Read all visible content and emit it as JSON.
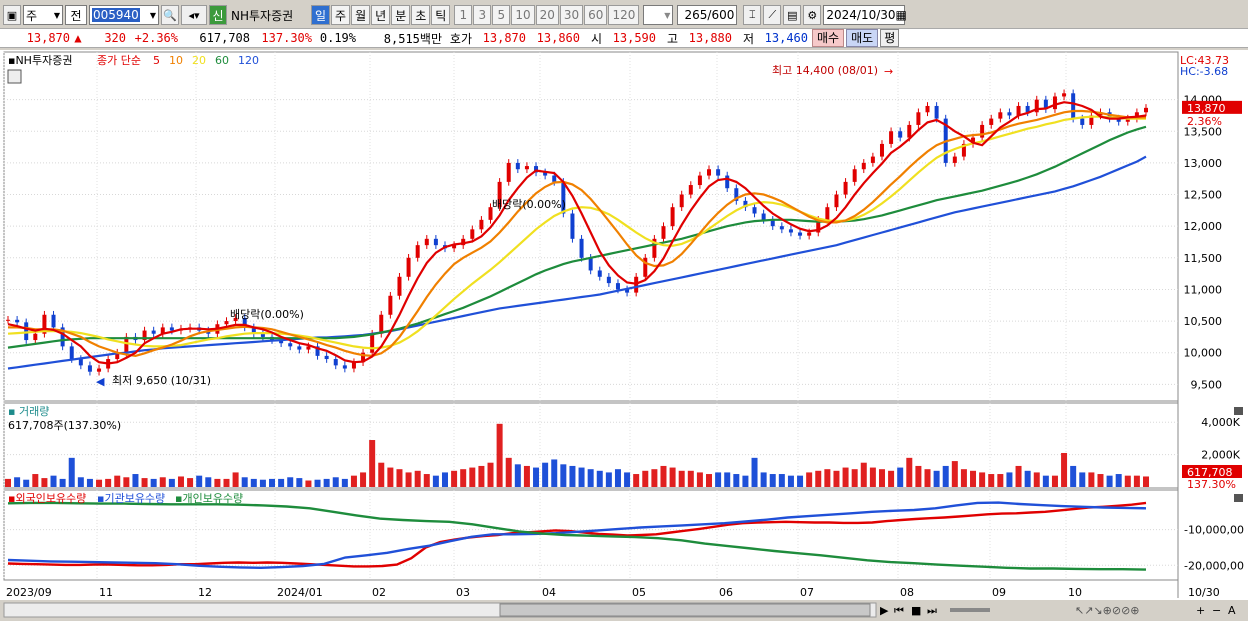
{
  "toolbar": {
    "period_type": "주",
    "prev_label": "전",
    "stock_code": "005940",
    "new_badge": "신",
    "stock_name": "NH투자증권",
    "period_tabs": [
      "일",
      "주",
      "월",
      "년",
      "분",
      "초",
      "틱"
    ],
    "selected_period": "일",
    "interval_buttons": [
      "1",
      "3",
      "5",
      "10",
      "20",
      "30",
      "60",
      "120"
    ],
    "count_value": "265",
    "count_total": "/600",
    "date_value": "2024/10/30"
  },
  "quote": {
    "price": "13,870",
    "arrow": "▲",
    "change": "320",
    "change_pct": "+2.36%",
    "volume": "617,708",
    "volume_ratio": "137.30%",
    "turnover": "0.19%",
    "amount": "8,515백만",
    "ask_label": "호가",
    "ask": "13,870",
    "bid": "13,860",
    "open_label": "시",
    "open": "13,590",
    "high_label": "고",
    "high": "13,880",
    "low_label": "저",
    "low": "13,460",
    "buy_label": "매수",
    "sell_label": "매도",
    "eval_label": "평"
  },
  "chart_data": {
    "type": "line",
    "price_panel": {
      "title": "NH투자증권",
      "legend_prefix": "종가 단순",
      "ma_periods": [
        "5",
        "10",
        "20",
        "60",
        "120"
      ],
      "ma_colors": [
        "#e00000",
        "#f08000",
        "#f0e020",
        "#1e8c3c",
        "#2050d8"
      ],
      "ylim": [
        9300,
        14500
      ],
      "yticks": [
        "14,000",
        "13,500",
        "13,000",
        "12,500",
        "12,000",
        "11,500",
        "11,000",
        "10,500",
        "10,000",
        "9,500"
      ],
      "lc_label": "LC:43.73",
      "hc_label": "HC:-3.68",
      "current_price_label": "13,870",
      "current_pct_label": "2.36%",
      "annotations": [
        {
          "text": "최고 14,400 (08/01)",
          "x": "2024/08/01",
          "y": 14400
        },
        {
          "text": "최저 9,650 (10/31)",
          "x": "2023/10/31",
          "y": 9650
        },
        {
          "text": "배당락(0.00%)",
          "x": "2023/12/27",
          "y": 10300
        },
        {
          "text": "배당락(0.00%)",
          "x": "2024/03/28",
          "y": 12000
        }
      ],
      "close_series": [
        10520,
        10480,
        10200,
        10300,
        10600,
        10400,
        10100,
        9900,
        9800,
        9700,
        9750,
        9900,
        10000,
        10250,
        10200,
        10350,
        10300,
        10400,
        10350,
        10380,
        10400,
        10350,
        10300,
        10450,
        10500,
        10550,
        10400,
        10300,
        10250,
        10200,
        10150,
        10100,
        10050,
        10100,
        9950,
        9900,
        9800,
        9750,
        9850,
        10000,
        10300,
        10600,
        10900,
        11200,
        11500,
        11700,
        11800,
        11700,
        11650,
        11700,
        11800,
        11950,
        12100,
        12300,
        12700,
        13000,
        12900,
        12950,
        12850,
        12800,
        12700,
        12200,
        11800,
        11500,
        11300,
        11200,
        11100,
        11000,
        10950,
        11200,
        11500,
        11800,
        12000,
        12300,
        12500,
        12650,
        12800,
        12900,
        12800,
        12600,
        12400,
        12300,
        12200,
        12100,
        12000,
        11950,
        11900,
        11850,
        11900,
        12100,
        12300,
        12500,
        12700,
        12900,
        13000,
        13100,
        13300,
        13500,
        13400,
        13600,
        13800,
        13900,
        13700,
        13000,
        13100,
        13300,
        13400,
        13600,
        13700,
        13800,
        13750,
        13900,
        13800,
        14000,
        13850,
        14050,
        14100,
        13700,
        13600,
        13750,
        13800,
        13700,
        13650,
        13700,
        13800,
        13870
      ],
      "ma5": [
        10450,
        10420,
        10380,
        10350,
        10380,
        10360,
        10300,
        10200,
        10100,
        9950,
        9850,
        9830,
        9850,
        9920,
        10000,
        10150,
        10230,
        10300,
        10330,
        10370,
        10380,
        10380,
        10370,
        10380,
        10410,
        10440,
        10440,
        10400,
        10370,
        10320,
        10250,
        10200,
        10150,
        10120,
        10070,
        10030,
        9960,
        9880,
        9850,
        9860,
        9940,
        10100,
        10330,
        10600,
        10900,
        11180,
        11420,
        11580,
        11670,
        11710,
        11730,
        11760,
        11840,
        11980,
        12170,
        12410,
        12600,
        12770,
        12880,
        12860,
        12840,
        12700,
        12480,
        12200,
        11900,
        11600,
        11380,
        11220,
        11110,
        11090,
        11150,
        11290,
        11490,
        11760,
        12020,
        12250,
        12450,
        12630,
        12730,
        12750,
        12700,
        12600,
        12460,
        12320,
        12200,
        12110,
        12030,
        11960,
        11920,
        11940,
        12010,
        12130,
        12300,
        12500,
        12680,
        12840,
        12990,
        13160,
        13260,
        13380,
        13520,
        13640,
        13680,
        13600,
        13500,
        13420,
        13320,
        13280,
        13420,
        13560,
        13650,
        13750,
        13790,
        13850,
        13860,
        13920,
        13960,
        13940,
        13900,
        13840,
        13730,
        13700,
        13700,
        13720,
        13730,
        13750
      ],
      "ma10": [
        10400,
        10400,
        10390,
        10370,
        10370,
        10370,
        10350,
        10300,
        10250,
        10170,
        10100,
        10050,
        10000,
        9970,
        9950,
        9990,
        10040,
        10080,
        10130,
        10190,
        10260,
        10310,
        10340,
        10360,
        10380,
        10400,
        10410,
        10400,
        10390,
        10370,
        10330,
        10290,
        10250,
        10210,
        10170,
        10120,
        10080,
        10030,
        9990,
        9960,
        9950,
        9990,
        10090,
        10250,
        10450,
        10660,
        10880,
        11080,
        11250,
        11400,
        11500,
        11580,
        11660,
        11760,
        11900,
        12060,
        12230,
        12380,
        12520,
        12620,
        12690,
        12700,
        12660,
        12570,
        12430,
        12260,
        12080,
        11900,
        11710,
        11540,
        11420,
        11370,
        11380,
        11440,
        11560,
        11720,
        11890,
        12060,
        12210,
        12340,
        12440,
        12500,
        12520,
        12500,
        12450,
        12390,
        12310,
        12230,
        12150,
        12090,
        12060,
        12060,
        12090,
        12160,
        12260,
        12380,
        12520,
        12660,
        12790,
        12930,
        13060,
        13180,
        13280,
        13340,
        13380,
        13420,
        13440,
        13450,
        13480,
        13530,
        13580,
        13620,
        13650,
        13680,
        13720,
        13760,
        13800,
        13820,
        13820,
        13810,
        13790,
        13760,
        13740,
        13720,
        13720,
        13720
      ],
      "ma20": [
        10300,
        10310,
        10320,
        10330,
        10340,
        10340,
        10340,
        10330,
        10310,
        10280,
        10250,
        10210,
        10180,
        10150,
        10130,
        10110,
        10100,
        10100,
        10110,
        10120,
        10150,
        10180,
        10210,
        10230,
        10260,
        10280,
        10300,
        10310,
        10310,
        10310,
        10300,
        10290,
        10270,
        10250,
        10220,
        10190,
        10160,
        10130,
        10100,
        10080,
        10070,
        10080,
        10110,
        10160,
        10240,
        10340,
        10460,
        10590,
        10720,
        10850,
        10970,
        11090,
        11200,
        11310,
        11430,
        11560,
        11690,
        11820,
        11950,
        12060,
        12160,
        12230,
        12280,
        12300,
        12290,
        12250,
        12190,
        12100,
        12000,
        11900,
        11810,
        11740,
        11700,
        11690,
        11720,
        11780,
        11860,
        11960,
        12060,
        12160,
        12250,
        12320,
        12360,
        12380,
        12370,
        12340,
        12290,
        12230,
        12170,
        12120,
        12090,
        12080,
        12090,
        12120,
        12180,
        12260,
        12360,
        12470,
        12590,
        12720,
        12850,
        12970,
        13080,
        13160,
        13220,
        13270,
        13310,
        13340,
        13380,
        13420,
        13460,
        13500,
        13540,
        13570,
        13610,
        13640,
        13680,
        13700,
        13720,
        13730,
        13730,
        13720,
        13710,
        13700,
        13700,
        13700
      ],
      "ma60": [
        10080,
        10100,
        10120,
        10140,
        10160,
        10180,
        10200,
        10210,
        10220,
        10230,
        10230,
        10230,
        10230,
        10230,
        10230,
        10230,
        10230,
        10230,
        10230,
        10230,
        10230,
        10230,
        10230,
        10230,
        10230,
        10230,
        10230,
        10230,
        10230,
        10230,
        10230,
        10230,
        10230,
        10230,
        10230,
        10230,
        10230,
        10240,
        10250,
        10270,
        10290,
        10320,
        10350,
        10380,
        10420,
        10460,
        10510,
        10560,
        10610,
        10660,
        10710,
        10770,
        10830,
        10890,
        10960,
        11030,
        11100,
        11170,
        11240,
        11300,
        11350,
        11400,
        11440,
        11470,
        11500,
        11530,
        11560,
        11590,
        11620,
        11650,
        11680,
        11710,
        11740,
        11770,
        11800,
        11840,
        11880,
        11920,
        11960,
        12000,
        12030,
        12060,
        12080,
        12090,
        12100,
        12100,
        12100,
        12090,
        12080,
        12070,
        12070,
        12070,
        12080,
        12090,
        12110,
        12140,
        12170,
        12210,
        12250,
        12290,
        12330,
        12370,
        12410,
        12440,
        12470,
        12500,
        12530,
        12560,
        12600,
        12640,
        12680,
        12720,
        12770,
        12820,
        12880,
        12940,
        13010,
        13080,
        13150,
        13220,
        13290,
        13360,
        13420,
        13480,
        13530,
        13570
      ],
      "ma120": [
        9750,
        9770,
        9790,
        9810,
        9830,
        9850,
        9870,
        9890,
        9910,
        9930,
        9950,
        9970,
        9990,
        10000,
        10020,
        10040,
        10050,
        10070,
        10080,
        10090,
        10100,
        10110,
        10120,
        10130,
        10140,
        10150,
        10160,
        10170,
        10180,
        10190,
        10200,
        10210,
        10220,
        10230,
        10240,
        10240,
        10250,
        10260,
        10270,
        10280,
        10300,
        10320,
        10340,
        10370,
        10400,
        10430,
        10460,
        10490,
        10520,
        10550,
        10580,
        10610,
        10640,
        10670,
        10700,
        10720,
        10740,
        10760,
        10780,
        10800,
        10820,
        10840,
        10860,
        10880,
        10900,
        10920,
        10950,
        10980,
        11010,
        11040,
        11070,
        11100,
        11130,
        11160,
        11190,
        11220,
        11250,
        11280,
        11310,
        11340,
        11370,
        11400,
        11430,
        11460,
        11490,
        11520,
        11550,
        11580,
        11610,
        11640,
        11670,
        11700,
        11740,
        11780,
        11820,
        11860,
        11900,
        11940,
        11980,
        12020,
        12060,
        12100,
        12140,
        12180,
        12220,
        12250,
        12280,
        12310,
        12340,
        12370,
        12400,
        12430,
        12460,
        12490,
        12520,
        12550,
        12590,
        12630,
        12680,
        12730,
        12780,
        12840,
        12900,
        12960,
        13020,
        13100
      ]
    },
    "volume_panel": {
      "title": "거래량",
      "current_label": "617,708주(137.30%)",
      "ylim": [
        0,
        5000
      ],
      "yticks": [
        "4,000K",
        "2,000K"
      ],
      "current_value_label": "617,708",
      "current_pct_label": "137.30%",
      "values": [
        500,
        600,
        450,
        800,
        550,
        700,
        500,
        1800,
        600,
        500,
        450,
        500,
        700,
        600,
        800,
        550,
        500,
        600,
        500,
        650,
        550,
        700,
        600,
        500,
        500,
        900,
        600,
        500,
        450,
        500,
        500,
        600,
        550,
        400,
        450,
        500,
        600,
        500,
        700,
        900,
        2900,
        1500,
        1200,
        1100,
        900,
        1000,
        800,
        700,
        900,
        1000,
        1100,
        1200,
        1300,
        1500,
        3900,
        1800,
        1400,
        1300,
        1200,
        1500,
        1700,
        1400,
        1300,
        1200,
        1100,
        1000,
        900,
        1100,
        900,
        800,
        1000,
        1100,
        1300,
        1200,
        1000,
        1000,
        900,
        800,
        900,
        900,
        800,
        700,
        1800,
        900,
        800,
        800,
        700,
        700,
        900,
        1000,
        1100,
        1000,
        1200,
        1100,
        1500,
        1200,
        1100,
        1000,
        1200,
        1800,
        1300,
        1100,
        1000,
        1300,
        1600,
        1100,
        1000,
        900,
        800,
        800,
        900,
        1300,
        1000,
        900,
        700,
        700,
        2100,
        1300,
        900,
        900,
        800,
        700,
        800,
        700,
        700,
        650
      ]
    },
    "holdings_panel": {
      "series_names": [
        "외국인보유수량",
        "기관보유수량",
        "개인보유수량"
      ],
      "series_colors": [
        "#e00000",
        "#2050d8",
        "#1e8c3c"
      ],
      "ylim": [
        -23000000,
        0
      ],
      "yticks": [
        "-10,000,00",
        "-20,000,00"
      ],
      "foreign": [
        -19500000,
        -19600000,
        -19700000,
        -19800000,
        -19900000,
        -19900000,
        -19800000,
        -19800000,
        -19900000,
        -20000000,
        -20000000,
        -19900000,
        -19700000,
        -19700000,
        -19500000,
        -19300000,
        -19200000,
        -19300000,
        -19200000,
        -19300000,
        -19500000,
        -19700000,
        -19900000,
        -20100000,
        -20300000,
        -20300000,
        -20200000,
        -19800000,
        -18000000,
        -15000000,
        -13500000,
        -12800000,
        -12200000,
        -11800000,
        -11500000,
        -11000000,
        -10800000,
        -10500000,
        -10200000,
        -10400000,
        -10800000,
        -11200000,
        -11400000,
        -11600000,
        -11500000,
        -11300000,
        -10800000,
        -10300000,
        -9800000,
        -9200000,
        -8600000,
        -8200000,
        -8000000,
        -7900000,
        -7800000,
        -7900000,
        -8000000,
        -8000000,
        -8100000,
        -8100000,
        -8000000,
        -7600000,
        -7300000,
        -7000000,
        -6800000,
        -6600000,
        -6300000,
        -6000000,
        -5700000,
        -5500000,
        -5400000,
        -5200000,
        -5000000,
        -4600000,
        -4200000,
        -3800000,
        -3600000,
        -3300000,
        -3000000,
        -2500000
      ],
      "institution": [
        -18500000,
        -18700000,
        -18900000,
        -19000000,
        -19100000,
        -19200000,
        -19300000,
        -19400000,
        -19700000,
        -20100000,
        -20400000,
        -20600000,
        -20700000,
        -20500000,
        -20200000,
        -19600000,
        -17800000,
        -17200000,
        -16500000,
        -15400000,
        -14500000,
        -13200000,
        -12000000,
        -11300000,
        -11300000,
        -11200000,
        -11000000,
        -10600000,
        -10200000,
        -9800000,
        -9400000,
        -9100000,
        -8800000,
        -8500000,
        -8200000,
        -7700000,
        -7200000,
        -6600000,
        -6200000,
        -5800000,
        -5400000,
        -5000000,
        -4700000,
        -4500000,
        -4000000,
        -3200000,
        -2500000,
        -2400000,
        -2800000,
        -3100000,
        -3400000,
        -3600000,
        -3800000,
        -3900000,
        -4000000
      ],
      "individual": [
        -2600000,
        -2500000,
        -2500000,
        -2600000,
        -2700000,
        -2700000,
        -2800000,
        -2900000,
        -2900000,
        -2900000,
        -3000000,
        -3200000,
        -3500000,
        -4000000,
        -5000000,
        -6000000,
        -6900000,
        -7300000,
        -7600000,
        -7800000,
        -8500000,
        -9500000,
        -10500000,
        -11100000,
        -11500000,
        -11700000,
        -11900000,
        -12100000,
        -12400000,
        -13000000,
        -13900000,
        -14600000,
        -15300000,
        -16000000,
        -16600000,
        -17200000,
        -17900000,
        -18600000,
        -19100000,
        -19400000,
        -19800000,
        -20100000,
        -20400000,
        -20700000,
        -20900000,
        -20900000,
        -21000000,
        -21100000,
        -21100000,
        -21200000
      ]
    },
    "x_tick_labels": [
      "2023/09",
      "11",
      "12",
      "2024/01",
      "02",
      "03",
      "04",
      "05",
      "06",
      "07",
      "08",
      "09",
      "10",
      "10/30"
    ],
    "grid": true
  }
}
